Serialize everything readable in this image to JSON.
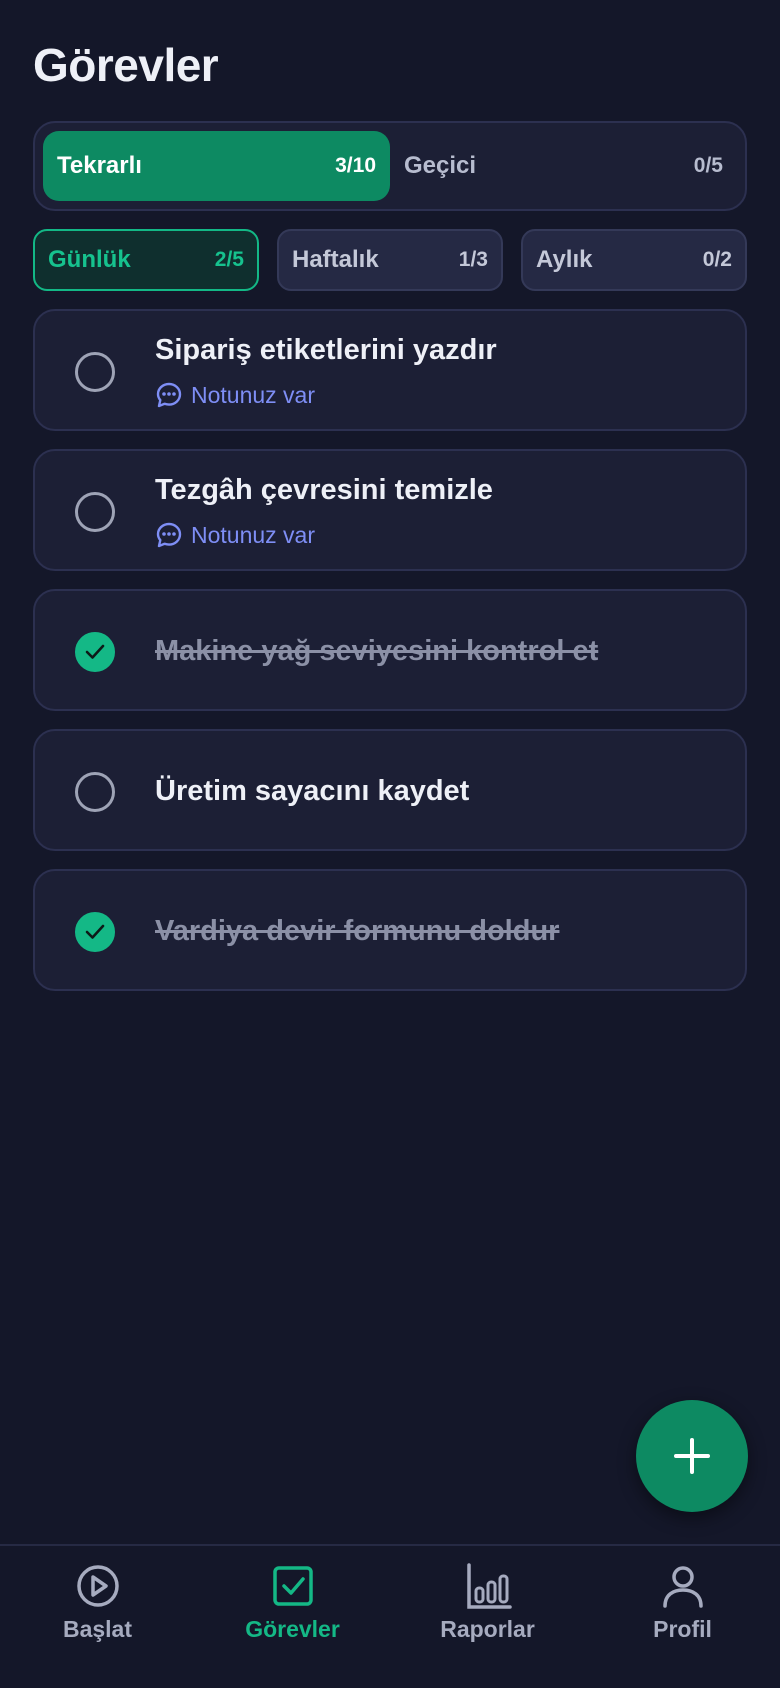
{
  "header": {
    "title": "Görevler"
  },
  "segment": {
    "items": [
      {
        "label": "Tekrarlı",
        "count": "3/10",
        "active": true
      },
      {
        "label": "Geçici",
        "count": "0/5",
        "active": false
      }
    ]
  },
  "period_tabs": [
    {
      "label": "Günlük",
      "count": "2/5",
      "active": true
    },
    {
      "label": "Haftalık",
      "count": "1/3",
      "active": false
    },
    {
      "label": "Aylık",
      "count": "0/2",
      "active": false
    }
  ],
  "tasks": [
    {
      "title": "Sipariş etiketlerini yazdır",
      "note": "Notunuz var",
      "done": false
    },
    {
      "title": "Tezgâh çevresini temizle",
      "note": "Notunuz var",
      "done": false
    },
    {
      "title": "Makine yağ seviyesini kontrol et",
      "done": true
    },
    {
      "title": "Üretim sayacını kaydet",
      "done": false
    },
    {
      "title": "Vardiya devir formunu doldur",
      "done": true
    }
  ],
  "fab": {
    "icon": "plus-icon"
  },
  "bottom_nav": [
    {
      "label": "Başlat",
      "icon": "play-circle-icon",
      "active": false
    },
    {
      "label": "Görevler",
      "icon": "checkbox-icon",
      "active": true
    },
    {
      "label": "Raporlar",
      "icon": "bar-chart-icon",
      "active": false
    },
    {
      "label": "Profil",
      "icon": "user-icon",
      "active": false
    }
  ],
  "colors": {
    "accent": "#0d8a62",
    "accent_bright": "#14b886",
    "background": "#141729",
    "card": "#1c1f35",
    "note": "#7e8ef5"
  }
}
